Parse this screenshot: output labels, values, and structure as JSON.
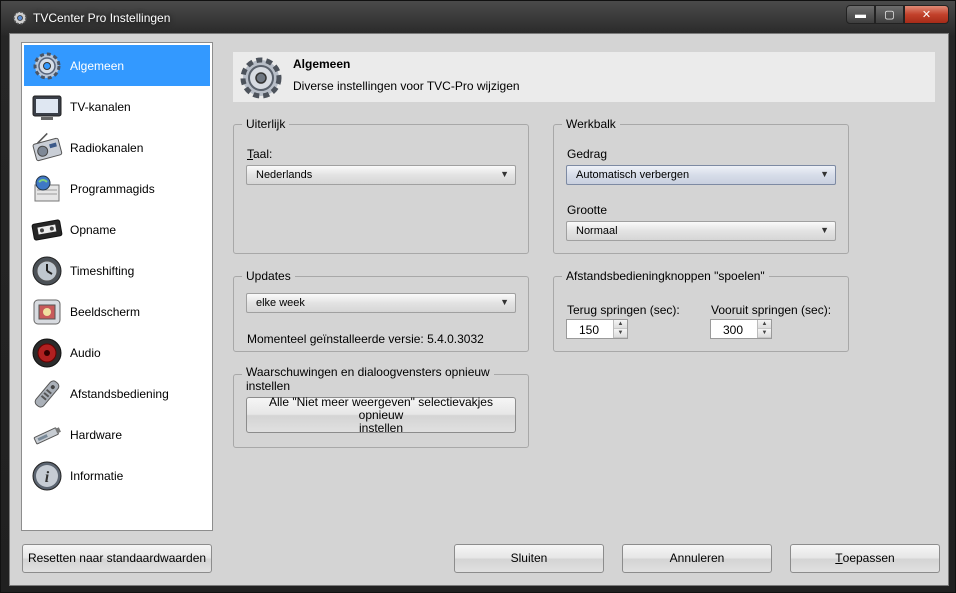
{
  "window": {
    "title": "TVCenter Pro Instellingen",
    "controls": {
      "minimize": "▬",
      "maximize": "▢",
      "close": "✕"
    }
  },
  "nav": {
    "items": [
      {
        "label": "Algemeen",
        "icon": "gear-icon",
        "selected": true
      },
      {
        "label": "TV-kanalen",
        "icon": "tv-icon"
      },
      {
        "label": "Radiokanalen",
        "icon": "radio-icon"
      },
      {
        "label": "Programmagids",
        "icon": "guide-icon"
      },
      {
        "label": "Opname",
        "icon": "tape-icon"
      },
      {
        "label": "Timeshifting",
        "icon": "clock-icon"
      },
      {
        "label": "Beeldscherm",
        "icon": "display-icon"
      },
      {
        "label": "Audio",
        "icon": "speaker-icon"
      },
      {
        "label": "Afstandsbediening",
        "icon": "remote-icon"
      },
      {
        "label": "Hardware",
        "icon": "hardware-icon"
      },
      {
        "label": "Informatie",
        "icon": "info-icon"
      }
    ]
  },
  "header": {
    "title": "Algemeen",
    "subtitle": "Diverse instellingen voor TVC-Pro wijzigen"
  },
  "uiterlijk": {
    "legend": "Uiterlijk",
    "taal_label_prefix": "T",
    "taal_label_rest": "aal:",
    "taal_value": "Nederlands"
  },
  "werkbalk": {
    "legend": "Werkbalk",
    "gedrag_label": "Gedrag",
    "gedrag_value": "Automatisch verbergen",
    "grootte_label": "Grootte",
    "grootte_value": "Normaal"
  },
  "updates": {
    "legend": "Updates",
    "frequency_value": "elke week",
    "version_text": "Momenteel geïnstalleerde versie: 5.4.0.3032"
  },
  "afstand": {
    "legend": "Afstandsbedieningknoppen \"spoelen\"",
    "terug_label": "Terug springen (sec):",
    "terug_value": "150",
    "vooruit_label": "Vooruit springen (sec):",
    "vooruit_value": "300"
  },
  "waarschuwingen": {
    "legend_line1": "Waarschuwingen en dialoogvensters opnieuw",
    "legend_line2": "instellen",
    "button_line1": "Alle \"Niet meer weergeven\" selectievakjes opnieuw",
    "button_line2": "instellen"
  },
  "footer": {
    "reset_label": "Resetten naar standaardwaarden",
    "close_label": "Sluiten",
    "cancel_label": "Annuleren",
    "apply_prefix": "T",
    "apply_rest": "oepassen"
  },
  "colors": {
    "selection": "#3399ff",
    "client_bg": "#d4d4d4",
    "header_bg": "#ebebeb"
  }
}
